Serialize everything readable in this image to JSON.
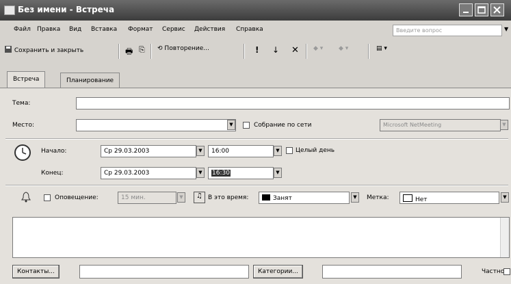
{
  "window": {
    "title": "Без имени - Встреча"
  },
  "menu": {
    "items": [
      "Файл",
      "Правка",
      "Вид",
      "Вставка",
      "Формат",
      "Сервис",
      "Действия",
      "Справка"
    ],
    "question_placeholder": "Введите вопрос"
  },
  "toolbar": {
    "save_close": "Сохранить и закрыть",
    "recurrence": "Повторение..."
  },
  "tabs": [
    "Встреча",
    "Планирование"
  ],
  "form": {
    "subject_label": "Тема:",
    "subject_value": "",
    "location_label": "Место:",
    "location_value": "",
    "online_meeting_label": "Собрание по сети",
    "netmeeting_value": "Microsoft NetMeeting",
    "start_label": "Начало:",
    "start_date": "Ср 29.03.2003",
    "start_time": "16:00",
    "allday_label": "Целый день",
    "end_label": "Конец:",
    "end_date": "Ср 29.03.2003",
    "end_time": "16:30",
    "reminder_label": "Оповещение:",
    "reminder_value": "15 мин.",
    "showas_label": "В это время:",
    "showas_value": "Занят",
    "showas_color": "#000000",
    "label_label": "Метка:",
    "label_value": "Нет",
    "contacts_button": "Контакты...",
    "categories_button": "Категории...",
    "private_label": "Частное"
  }
}
